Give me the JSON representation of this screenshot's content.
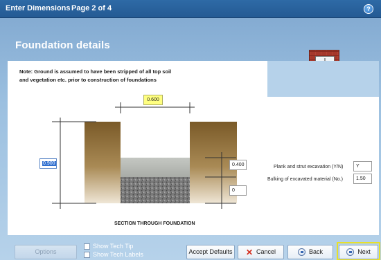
{
  "titlebar": {
    "title": "Enter Dimensions",
    "page": "Page 2 of 4",
    "help_symbol": "?"
  },
  "section": {
    "title": "Foundation details"
  },
  "note": "Note: Ground is assumed to have been stripped of all top soil and vegetation etc. prior to construction of foundations",
  "dimensions": {
    "width": "0.600",
    "depth": "0.900",
    "concrete_thickness": "0.400",
    "hardcore_thickness": "0"
  },
  "options": {
    "plank_strut_label": "Plank and strut excavation (Y/N)",
    "plank_strut_value": "Y",
    "bulking_label": "Bulking of excavated material (No.)",
    "bulking_value": "1.50"
  },
  "diagram": {
    "caption": "SECTION THROUGH FOUNDATION"
  },
  "footer": {
    "options_label": "Options",
    "show_tech_tip": "Show Tech Tip",
    "show_tech_labels": "Show Tech Labels",
    "accept_defaults": "Accept Defaults",
    "cancel": "Cancel",
    "back": "Back",
    "next": "Next"
  },
  "colors": {
    "titlebar": "#2e6aa6",
    "soil": "#8a6a38",
    "concrete": "#b7bab5",
    "hardcore": "#6d6d6d",
    "highlight": "#ffff80"
  }
}
